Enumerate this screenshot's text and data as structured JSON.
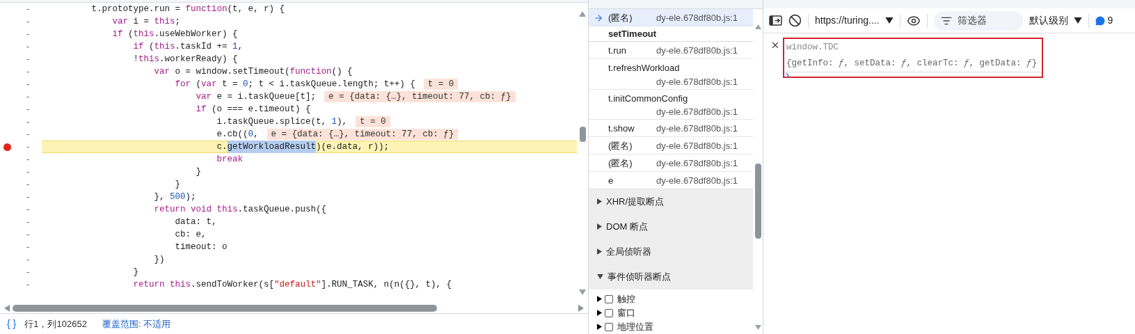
{
  "editor": {
    "lines": [
      {
        "paused": false,
        "breakpoint": false,
        "code": [
          {
            "kind": "plain",
            "text": "         t.prototype.run = "
          },
          {
            "kind": "kw",
            "text": "function"
          },
          {
            "kind": "plain",
            "text": "(t, e, r) {"
          }
        ]
      },
      {
        "paused": false,
        "breakpoint": false,
        "code": [
          {
            "kind": "kw",
            "text": "             var"
          },
          {
            "kind": "plain",
            "text": " i = "
          },
          {
            "kind": "kw",
            "text": "this"
          },
          {
            "kind": "plain",
            "text": ";"
          }
        ]
      },
      {
        "paused": false,
        "breakpoint": false,
        "code": [
          {
            "kind": "kw",
            "text": "             if"
          },
          {
            "kind": "plain",
            "text": " ("
          },
          {
            "kind": "kw",
            "text": "this"
          },
          {
            "kind": "plain",
            "text": ".useWebWorker) {"
          }
        ]
      },
      {
        "paused": false,
        "breakpoint": false,
        "code": [
          {
            "kind": "kw",
            "text": "                 if"
          },
          {
            "kind": "plain",
            "text": " ("
          },
          {
            "kind": "kw",
            "text": "this"
          },
          {
            "kind": "plain",
            "text": ".taskId += "
          },
          {
            "kind": "num",
            "text": "1"
          },
          {
            "kind": "plain",
            "text": ","
          }
        ]
      },
      {
        "paused": false,
        "breakpoint": false,
        "code": [
          {
            "kind": "plain",
            "text": "                 !"
          },
          {
            "kind": "kw",
            "text": "this"
          },
          {
            "kind": "plain",
            "text": ".workerReady) {"
          }
        ]
      },
      {
        "paused": false,
        "breakpoint": false,
        "code": [
          {
            "kind": "kw",
            "text": "                     var"
          },
          {
            "kind": "plain",
            "text": " o = window.setTimeout("
          },
          {
            "kind": "kw",
            "text": "function"
          },
          {
            "kind": "plain",
            "text": "() {"
          }
        ]
      },
      {
        "paused": false,
        "breakpoint": false,
        "inline_value": "t = 0",
        "code": [
          {
            "kind": "kw",
            "text": "                         for"
          },
          {
            "kind": "plain",
            "text": " ("
          },
          {
            "kind": "kw",
            "text": "var"
          },
          {
            "kind": "plain",
            "text": " t = "
          },
          {
            "kind": "num",
            "text": "0"
          },
          {
            "kind": "plain",
            "text": "; t < i.taskQueue.length; t++) {"
          }
        ]
      },
      {
        "paused": false,
        "breakpoint": false,
        "inline_value": "e = {data: {…}, timeout: 77, cb: ƒ}",
        "code": [
          {
            "kind": "kw",
            "text": "                             var"
          },
          {
            "kind": "plain",
            "text": " e = i.taskQueue[t];"
          }
        ]
      },
      {
        "paused": false,
        "breakpoint": false,
        "code": [
          {
            "kind": "kw",
            "text": "                             if"
          },
          {
            "kind": "plain",
            "text": " (o === e.timeout) {"
          }
        ]
      },
      {
        "paused": false,
        "breakpoint": false,
        "inline_value": "t = 0",
        "code": [
          {
            "kind": "plain",
            "text": "                                 i.taskQueue.splice(t, "
          },
          {
            "kind": "num",
            "text": "1"
          },
          {
            "kind": "plain",
            "text": "),"
          }
        ]
      },
      {
        "paused": false,
        "breakpoint": false,
        "inline_value": "e = {data: {…}, timeout: 77, cb: ƒ}",
        "code": [
          {
            "kind": "plain",
            "text": "                                 e.cb(("
          },
          {
            "kind": "num",
            "text": "0"
          },
          {
            "kind": "plain",
            "text": ","
          }
        ]
      },
      {
        "paused": true,
        "breakpoint": true,
        "code": [
          {
            "kind": "plain",
            "text": "                                 c."
          },
          {
            "kind": "sel",
            "text": "getWorkloadResult"
          },
          {
            "kind": "plain",
            "text": ")(e.data, r));"
          }
        ]
      },
      {
        "paused": false,
        "breakpoint": false,
        "code": [
          {
            "kind": "kw",
            "text": "                                 break"
          }
        ]
      },
      {
        "paused": false,
        "breakpoint": false,
        "code": [
          {
            "kind": "plain",
            "text": "                             }"
          }
        ]
      },
      {
        "paused": false,
        "breakpoint": false,
        "code": [
          {
            "kind": "plain",
            "text": "                         }"
          }
        ]
      },
      {
        "paused": false,
        "breakpoint": false,
        "code": [
          {
            "kind": "plain",
            "text": "                     }, "
          },
          {
            "kind": "num",
            "text": "500"
          },
          {
            "kind": "plain",
            "text": ");"
          }
        ]
      },
      {
        "paused": false,
        "breakpoint": false,
        "code": [
          {
            "kind": "kw",
            "text": "                     return void this"
          },
          {
            "kind": "plain",
            "text": ".taskQueue.push({"
          }
        ]
      },
      {
        "paused": false,
        "breakpoint": false,
        "code": [
          {
            "kind": "plain",
            "text": "                         data: t,"
          }
        ]
      },
      {
        "paused": false,
        "breakpoint": false,
        "code": [
          {
            "kind": "plain",
            "text": "                         cb: e,"
          }
        ]
      },
      {
        "paused": false,
        "breakpoint": false,
        "code": [
          {
            "kind": "plain",
            "text": "                         timeout: o"
          }
        ]
      },
      {
        "paused": false,
        "breakpoint": false,
        "code": [
          {
            "kind": "plain",
            "text": "                     })"
          }
        ]
      },
      {
        "paused": false,
        "breakpoint": false,
        "code": [
          {
            "kind": "plain",
            "text": "                 }"
          }
        ]
      },
      {
        "paused": false,
        "breakpoint": false,
        "code": [
          {
            "kind": "kw",
            "text": "                 return this"
          },
          {
            "kind": "plain",
            "text": ".sendToWorker(s["
          },
          {
            "kind": "str",
            "text": "\"default\""
          },
          {
            "kind": "plain",
            "text": "].RUN_TASK, n(n({}, t), {"
          }
        ]
      }
    ],
    "line_marker": "-",
    "status": {
      "format_icon": "{ }",
      "position": "行1，列102652",
      "coverage": "覆盖范围: 不适用"
    }
  },
  "call_stack": {
    "frames": [
      {
        "kind": "frame",
        "name": "(匿名)",
        "location": "dy-ele.678df80b.js:1",
        "selected": true
      },
      {
        "kind": "async",
        "name": "setTimeout",
        "selected": false
      },
      {
        "kind": "frame",
        "name": "t.run",
        "location": "dy-ele.678df80b.js:1",
        "selected": false
      },
      {
        "kind": "frame",
        "name": "t.refreshWorkload",
        "location": "dy-ele.678df80b.js:1",
        "selected": false
      },
      {
        "kind": "frame",
        "name": "t.initCommonConfig",
        "location": "dy-ele.678df80b.js:1",
        "selected": false
      },
      {
        "kind": "frame",
        "name": "t.show",
        "location": "dy-ele.678df80b.js:1",
        "selected": false
      },
      {
        "kind": "frame",
        "name": "(匿名)",
        "location": "dy-ele.678df80b.js:1",
        "selected": false
      },
      {
        "kind": "frame",
        "name": "(匿名)",
        "location": "dy-ele.678df80b.js:1",
        "selected": false
      },
      {
        "kind": "frame",
        "name": "e",
        "location": "dy-ele.678df80b.js:1",
        "selected": false
      }
    ]
  },
  "breakpoint_sections": [
    {
      "title": "XHR/提取断点",
      "expanded": false
    },
    {
      "title": "DOM 断点",
      "expanded": false
    },
    {
      "title": "全局侦听器",
      "expanded": false
    },
    {
      "title": "事件侦听器断点",
      "expanded": true
    }
  ],
  "event_listeners": [
    {
      "label": "触控",
      "checked": false,
      "expanded": false
    },
    {
      "label": "窗口",
      "checked": false,
      "expanded": false
    },
    {
      "label": "地理位置",
      "checked": false,
      "expanded": false
    }
  ],
  "console": {
    "toolbar": {
      "context": "https://turing....",
      "filter_placeholder": "筛选器",
      "level": "默认级别",
      "issues_count": "9"
    },
    "highlighted": true,
    "entries": [
      {
        "kind": "command",
        "text": "window.TDC"
      },
      {
        "kind": "result",
        "text": "{getInfo: *ƒ*, setData: *ƒ*, clearTc: *ƒ*, getData: *ƒ*}"
      }
    ]
  }
}
